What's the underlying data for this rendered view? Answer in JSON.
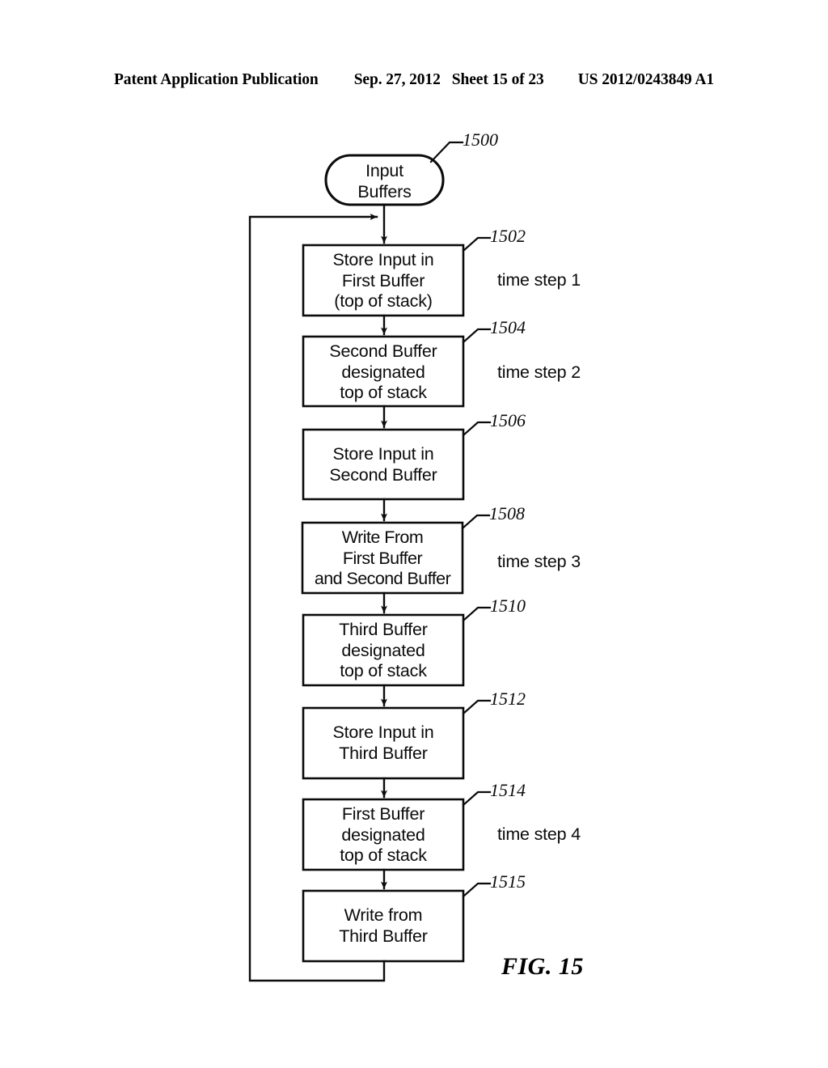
{
  "header": {
    "publication": "Patent Application Publication",
    "date": "Sep. 27, 2012",
    "sheet": "Sheet 15 of 23",
    "patent_number": "US 2012/0243849 A1"
  },
  "figure": {
    "label": "FIG. 15",
    "title_numeral": "1500"
  },
  "nodes": [
    {
      "id": "start",
      "ref": "1500",
      "shape": "stadium",
      "lines": [
        "Input",
        "Buffers"
      ],
      "text": "Input\nBuffers",
      "time_step": ""
    },
    {
      "id": "step-1502",
      "ref": "1502",
      "shape": "rect",
      "lines": [
        "Store Input in",
        "First Buffer",
        "(top of stack)"
      ],
      "text": "Store Input in\nFirst Buffer\n(top of stack)",
      "time_step": "time step 1"
    },
    {
      "id": "step-1504",
      "ref": "1504",
      "shape": "rect",
      "lines": [
        "Second Buffer",
        "designated",
        "top of stack"
      ],
      "text": "Second Buffer\ndesignated\ntop of stack",
      "time_step": "time step 2"
    },
    {
      "id": "step-1506",
      "ref": "1506",
      "shape": "rect",
      "lines": [
        "Store Input in",
        "Second Buffer"
      ],
      "text": "Store Input in\nSecond Buffer",
      "time_step": ""
    },
    {
      "id": "step-1508",
      "ref": "1508",
      "shape": "rect",
      "lines": [
        "Write From",
        "First Buffer",
        "and Second Buffer"
      ],
      "text": "Write From\nFirst Buffer\nand Second Buffer",
      "time_step": "time step 3"
    },
    {
      "id": "step-1510",
      "ref": "1510",
      "shape": "rect",
      "lines": [
        "Third Buffer",
        "designated",
        "top of stack"
      ],
      "text": "Third Buffer\ndesignated\ntop of stack",
      "time_step": ""
    },
    {
      "id": "step-1512",
      "ref": "1512",
      "shape": "rect",
      "lines": [
        "Store Input in",
        "Third Buffer"
      ],
      "text": "Store Input in\nThird Buffer",
      "time_step": ""
    },
    {
      "id": "step-1514",
      "ref": "1514",
      "shape": "rect",
      "lines": [
        "First Buffer",
        "designated",
        "top of stack"
      ],
      "text": "First Buffer\ndesignated\ntop of stack",
      "time_step": "time step 4"
    },
    {
      "id": "step-1515",
      "ref": "1515",
      "shape": "rect",
      "lines": [
        "Write from",
        "Third Buffer"
      ],
      "text": "Write from\nThird Buffer",
      "time_step": ""
    }
  ],
  "colors": {
    "ink": "#0b0b0b",
    "background": "#ffffff"
  }
}
